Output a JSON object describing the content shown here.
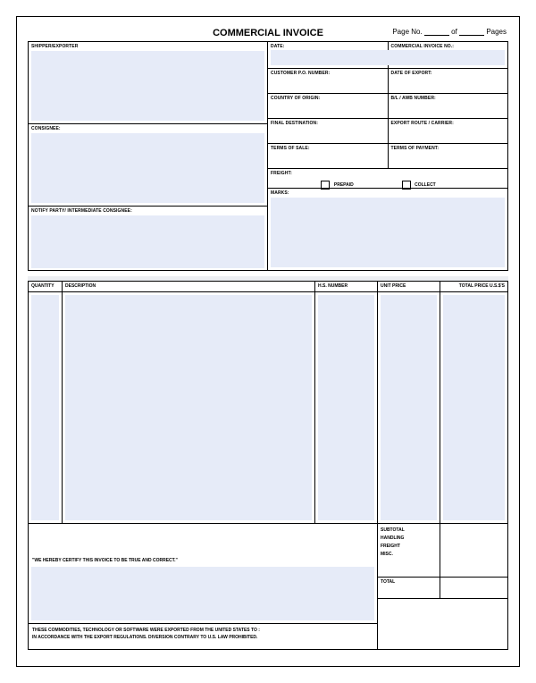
{
  "header": {
    "title": "COMMERCIAL INVOICE",
    "page_no_label": "Page No.",
    "of_label": "of",
    "pages_label": "Pages"
  },
  "left_boxes": {
    "shipper": "SHIPPER/EXPORTER",
    "consignee": "CONSIGNEE:",
    "notify": "NOTIFY PARTY/ INTERMEDIATE CONSIGNEE:"
  },
  "right_boxes": {
    "date": "DATE:",
    "invoice_no": "COMMERCIAL INVOICE NO.:",
    "po": "CUSTOMER P.O. NUMBER:",
    "export_date": "DATE OF EXPORT:",
    "origin": "COUNTRY OF ORIGIN:",
    "awb": "B/L / AWB NUMBER:",
    "destination": "FINAL DESTINATION:",
    "route": "EXPORT ROUTE / CARRIER:",
    "terms_sale": "TERMS OF SALE:",
    "terms_payment": "TERMS OF PAYMENT:",
    "freight": "FREIGHT:",
    "prepaid": "PREPAID",
    "collect": "COLLECT",
    "marks": "MARKS:"
  },
  "table": {
    "qty": "QUANTITY",
    "desc": "DESCRIPTION",
    "hsn": "H.S. NUMBER",
    "unit": "UNIT PRICE",
    "total": "TOTAL PRICE U.S.$'S"
  },
  "summary": {
    "subtotal": "SUBTOTAL",
    "handling": "HANDLING",
    "freight": "FREIGHT",
    "misc": "MISC.",
    "total": "TOTAL"
  },
  "cert": {
    "statement": "\"WE HEREBY CERTIFY THIS INVOICE TO BE TRUE AND CORRECT.\"",
    "export1": "THESE COMMODITIES, TECHNOLOGY OR SOFTWARE WERE EXPORTED FROM THE UNITED STATES TO :",
    "export2": "IN ACCORDANCE WITH THE EXPORT REGULATIONS. DIVERSION CONTRARY TO U.S. LAW PROHIBITED."
  }
}
